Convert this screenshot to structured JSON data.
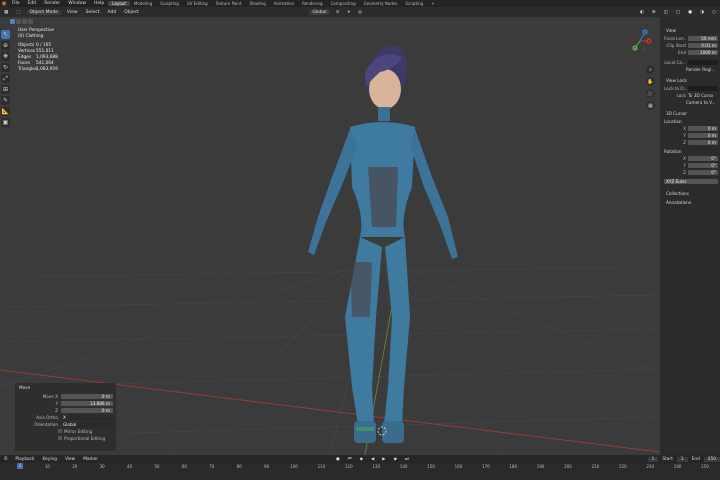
{
  "topbar": {
    "menus": [
      "File",
      "Edit",
      "Render",
      "Window",
      "Help"
    ],
    "workspaces": [
      "Layout",
      "Modeling",
      "Sculpting",
      "UV Editing",
      "Texture Paint",
      "Shading",
      "Animation",
      "Rendering",
      "Compositing",
      "Geometry Nodes",
      "Scripting"
    ],
    "active_workspace": "Layout",
    "add_tab": "+"
  },
  "header": {
    "mode": "Object Mode",
    "menus": [
      "View",
      "Select",
      "Add",
      "Object"
    ],
    "orientation": "Global"
  },
  "overlay": {
    "view_name": "User Perspective",
    "collection": "(0) Clothing",
    "stats": [
      {
        "k": "Objects",
        "v": "0 / 165"
      },
      {
        "k": "Vertices",
        "v": "551,011"
      },
      {
        "k": "Edges",
        "v": "1,093,688"
      },
      {
        "k": "Faces",
        "v": "541,064"
      },
      {
        "k": "Triangles",
        "v": "1,083,959"
      }
    ]
  },
  "gizmo": {
    "x": "X",
    "y": "Y",
    "z": "Z"
  },
  "npanel": {
    "view_title": "View",
    "focal_label": "Focal Len..",
    "focal_value": "50 mm",
    "clip_start_label": "Clip Start",
    "clip_start_value": "0.01 m",
    "end_label": "End",
    "end_value": "1000 m",
    "local_camera": "Local Ca...",
    "render_region": "Render Regi...",
    "view_lock_title": "View Lock",
    "lock_to_obj": "Lock to O...",
    "lock_label": "Lock",
    "lock_3d_cursor": "To 3D Curso",
    "camera_to_view": "Camera to V...",
    "cursor_title": "3D Cursor",
    "location_label": "Location",
    "loc_x": "0 m",
    "loc_y": "0 m",
    "loc_z": "0 m",
    "rotation_label": "Rotation",
    "rot_x": "0°",
    "rot_y": "0°",
    "rot_z": "0°",
    "rotation_mode": "XYZ Euler",
    "collections": "Collections",
    "annotations": "Annotations"
  },
  "operator_panel": {
    "title": "Move",
    "move_x_label": "Move X",
    "move_x": "0 m",
    "y_label": "Y",
    "y": "13.686 m",
    "z_label": "Z",
    "z": "0 m",
    "axis_label": "Axis Ortho",
    "axis": "X",
    "orientation_label": "Orientation",
    "orientation": "Global",
    "proportional": "Proportional Editing",
    "mirror": "Mirror Editing"
  },
  "timeline": {
    "menus": [
      "Playback",
      "Keying",
      "View",
      "Marker"
    ],
    "current_frame": "1",
    "start_label": "Start",
    "start": "1",
    "end_label": "End",
    "end": "250",
    "ticks": [
      "0",
      "10",
      "20",
      "30",
      "40",
      "50",
      "60",
      "70",
      "80",
      "90",
      "100",
      "110",
      "120",
      "130",
      "140",
      "150",
      "160",
      "170",
      "180",
      "190",
      "200",
      "210",
      "220",
      "230",
      "240",
      "250"
    ]
  },
  "colors": {
    "accent": "#4772b3",
    "x_axis": "#c0392b",
    "y_axis": "#6aa84f",
    "z_axis": "#3d7ad6"
  }
}
